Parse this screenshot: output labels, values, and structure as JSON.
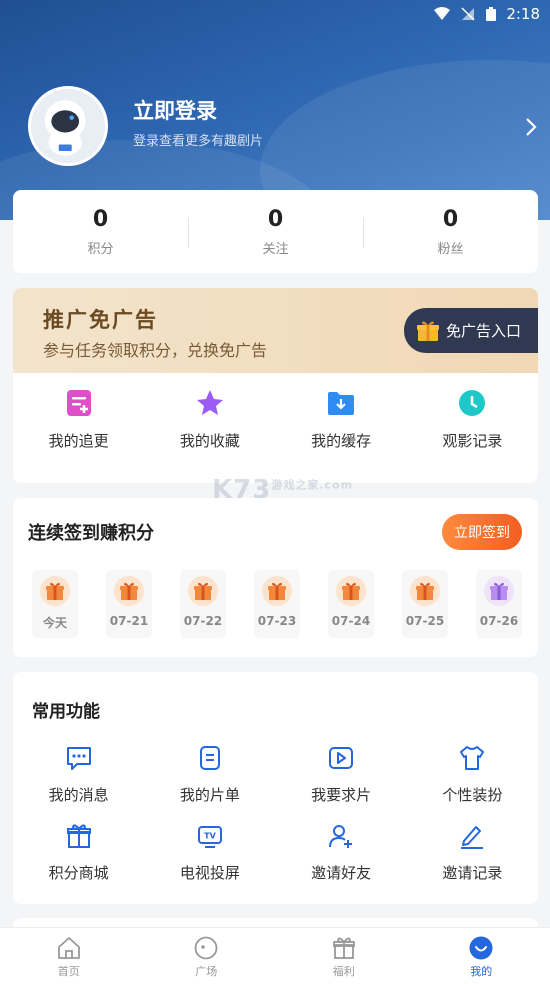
{
  "status_bar": {
    "time": "2:18"
  },
  "profile": {
    "title": "立即登录",
    "subtitle": "登录查看更多有趣剧片"
  },
  "stats": [
    {
      "value": "0",
      "label": "积分"
    },
    {
      "value": "0",
      "label": "关注"
    },
    {
      "value": "0",
      "label": "粉丝"
    }
  ],
  "promo": {
    "title": "推广免广告",
    "subtitle": "参与任务领取积分，兑换免广告",
    "button": "免广告入口"
  },
  "quick_links": [
    {
      "label": "我的追更",
      "icon": "follow-updates-icon"
    },
    {
      "label": "我的收藏",
      "icon": "star-icon"
    },
    {
      "label": "我的缓存",
      "icon": "download-folder-icon"
    },
    {
      "label": "观影记录",
      "icon": "clock-icon"
    }
  ],
  "signin": {
    "title": "连续签到赚积分",
    "button": "立即签到",
    "days": [
      "今天",
      "07-21",
      "07-22",
      "07-23",
      "07-24",
      "07-25",
      "07-26"
    ]
  },
  "functions": {
    "title": "常用功能",
    "items": [
      {
        "label": "我的消息",
        "icon": "message-icon"
      },
      {
        "label": "我的片单",
        "icon": "playlist-icon"
      },
      {
        "label": "我要求片",
        "icon": "request-video-icon"
      },
      {
        "label": "个性装扮",
        "icon": "shirt-icon"
      },
      {
        "label": "积分商城",
        "icon": "gift-shop-icon"
      },
      {
        "label": "电视投屏",
        "icon": "tv-cast-icon"
      },
      {
        "label": "邀请好友",
        "icon": "add-user-icon"
      },
      {
        "label": "邀请记录",
        "icon": "edit-record-icon"
      }
    ]
  },
  "watermark": {
    "text": "K73",
    "small": "游戏之家",
    "domain": ".com"
  },
  "tabs": [
    {
      "label": "首页",
      "icon": "home-icon",
      "active": false
    },
    {
      "label": "广场",
      "icon": "square-icon",
      "active": false
    },
    {
      "label": "福利",
      "icon": "gift-icon",
      "active": false
    },
    {
      "label": "我的",
      "icon": "profile-icon",
      "active": true
    }
  ],
  "colors": {
    "header": "#2d66b0",
    "accent": "#2567dc",
    "signin_button": "#f25e22",
    "icon_blue": "#2567dc"
  }
}
